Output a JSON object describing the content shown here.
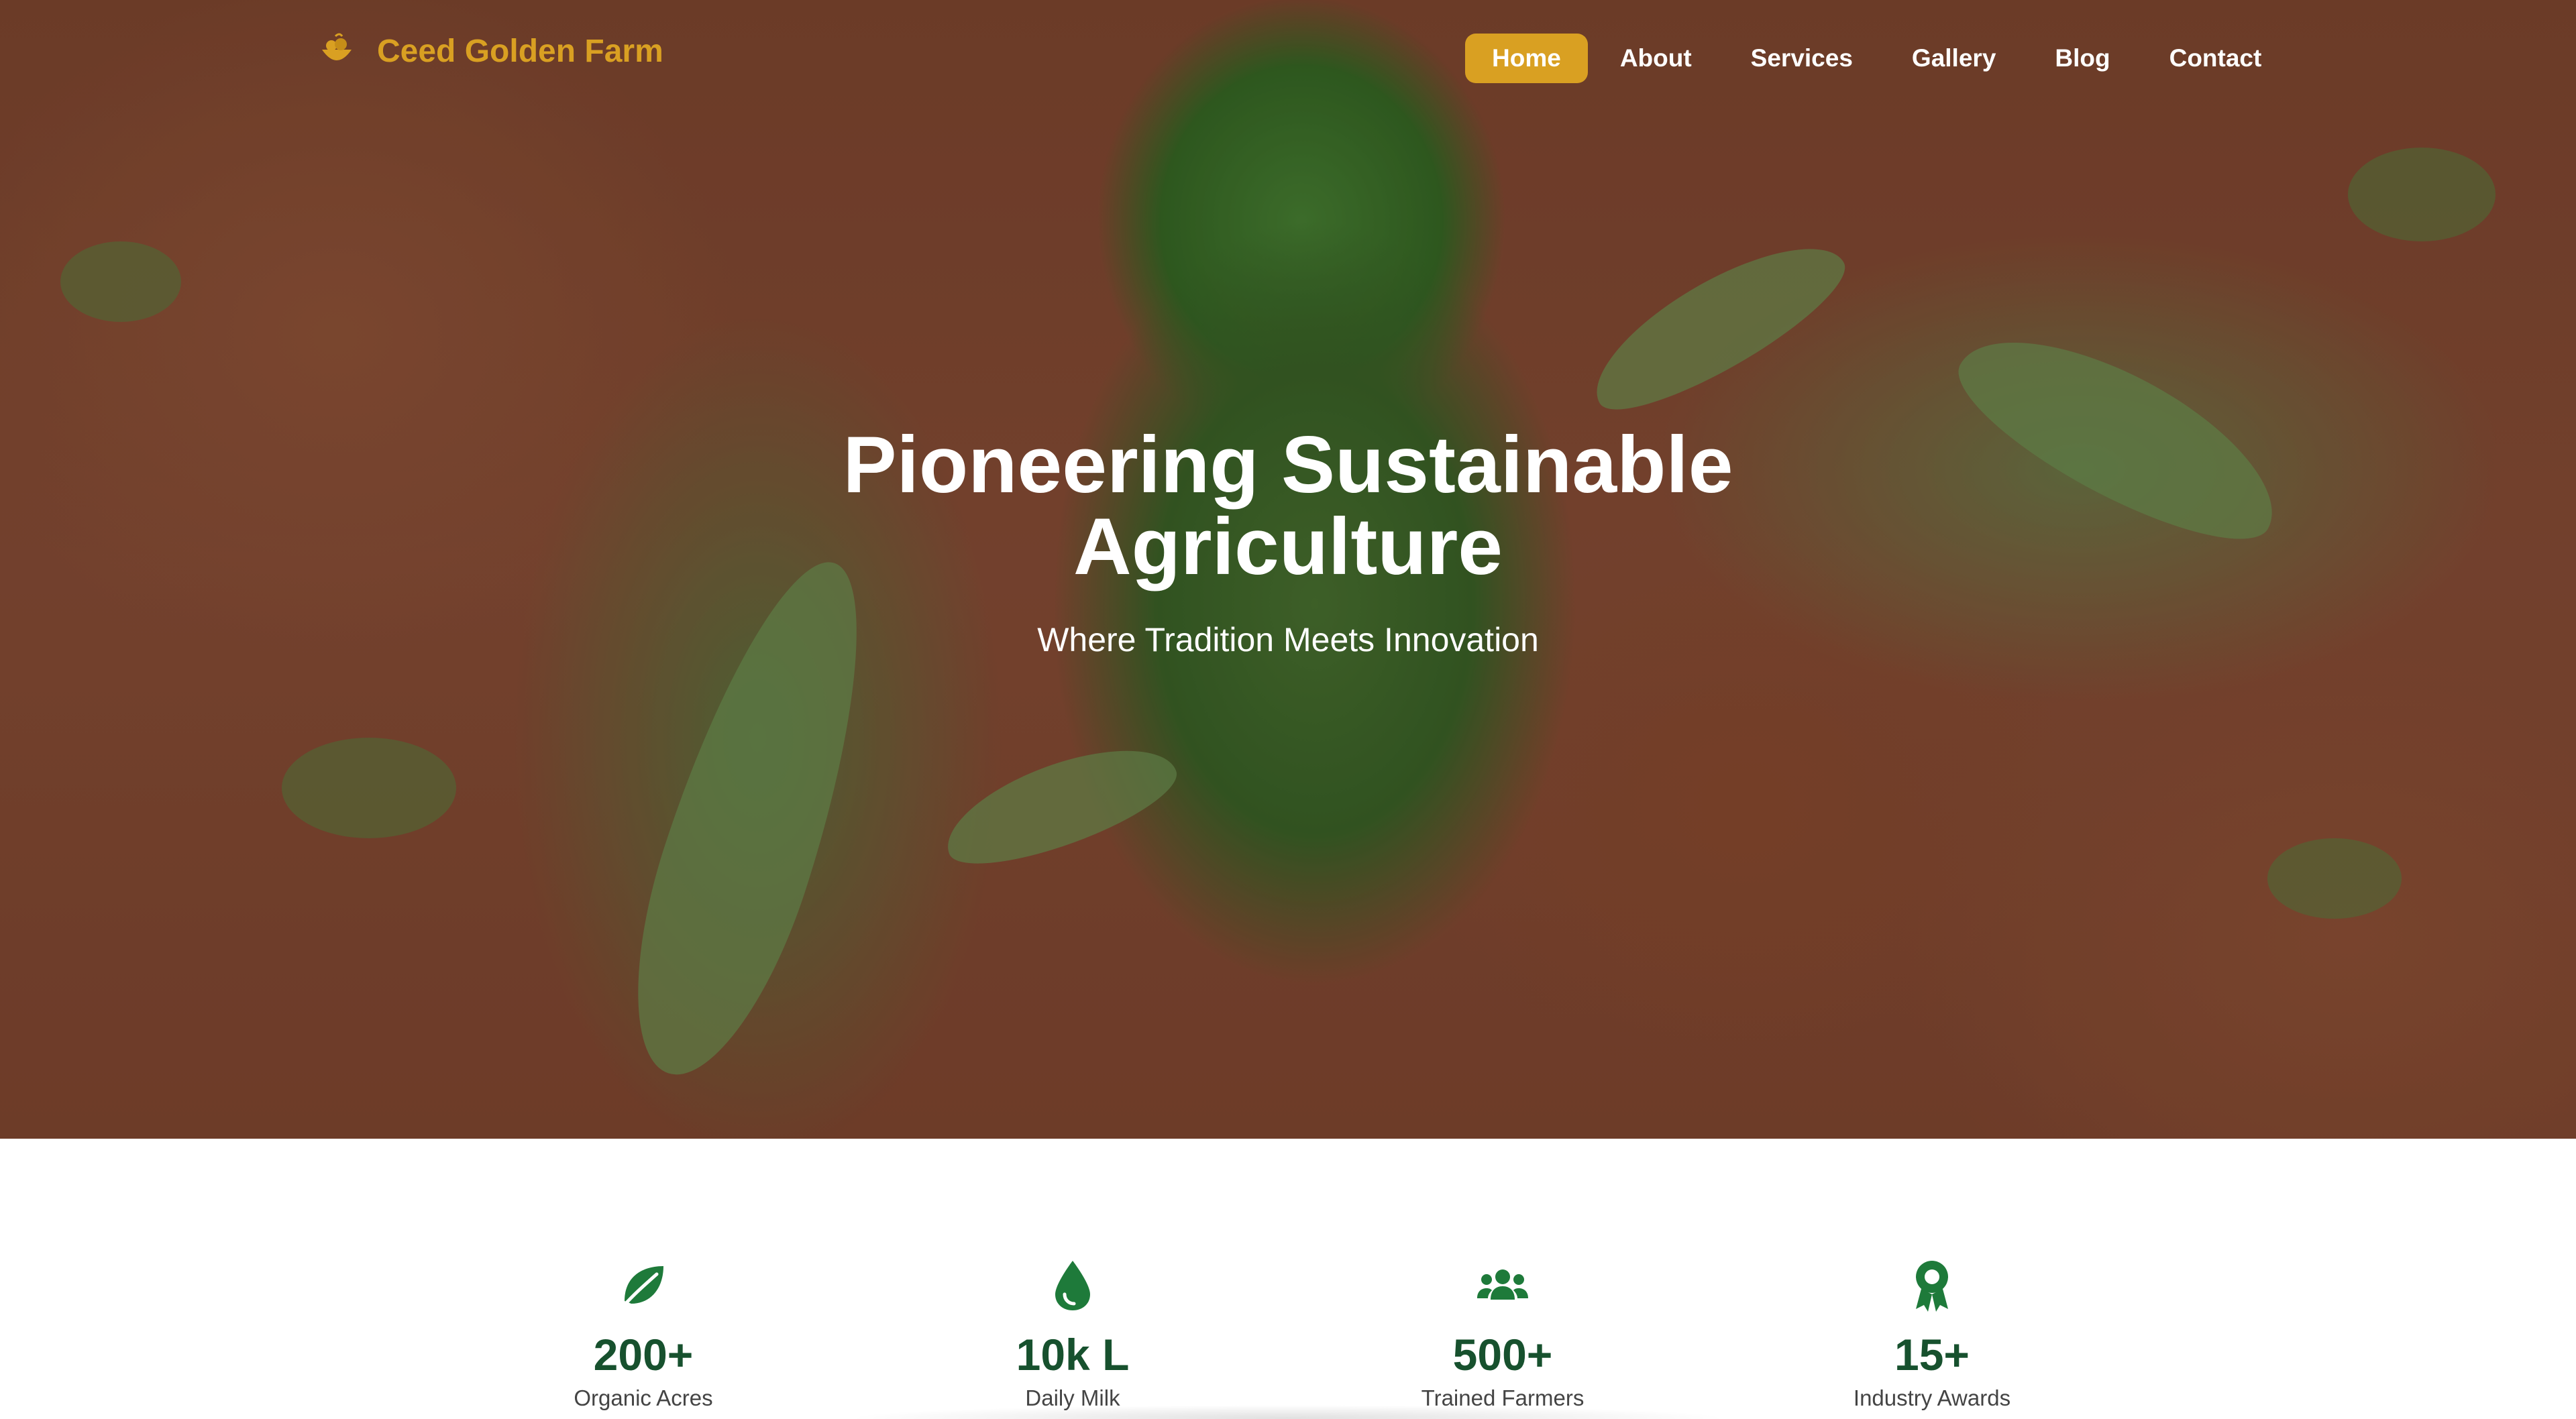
{
  "brand": {
    "name": "Ceed Golden Farm",
    "logo_icon": "golden-basket-icon",
    "accent": "#d9a022"
  },
  "nav": {
    "items": [
      {
        "label": "Home",
        "active": true
      },
      {
        "label": "About",
        "active": false
      },
      {
        "label": "Services",
        "active": false
      },
      {
        "label": "Gallery",
        "active": false
      },
      {
        "label": "Blog",
        "active": false
      },
      {
        "label": "Contact",
        "active": false
      }
    ]
  },
  "hero": {
    "title_line1": "Pioneering Sustainable",
    "title_line2": "Agriculture",
    "subtitle": "Where Tradition Meets Innovation"
  },
  "stats": [
    {
      "icon": "leaf-icon",
      "value": "200+",
      "label": "Organic Acres"
    },
    {
      "icon": "droplet-icon",
      "value": "10k L",
      "label": "Daily Milk"
    },
    {
      "icon": "users-icon",
      "value": "500+",
      "label": "Trained Farmers"
    },
    {
      "icon": "award-icon",
      "value": "15+",
      "label": "Industry Awards"
    }
  ],
  "colors": {
    "stat_green": "#17512e",
    "icon_green": "#1e7a3a"
  }
}
